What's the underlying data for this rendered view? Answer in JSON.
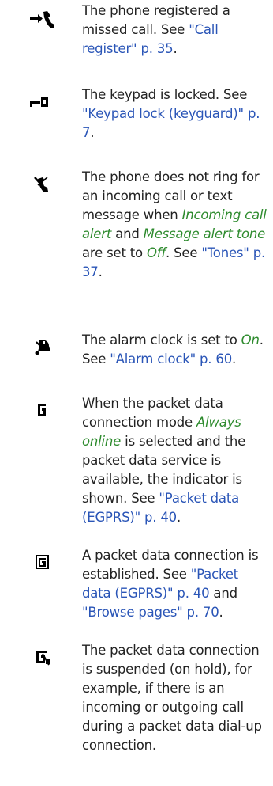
{
  "colors": {
    "text": "#222222",
    "link": "#2a55b7",
    "emphasis": "#2e8b2e"
  },
  "entries": [
    {
      "icon": "missed-call-icon",
      "t1": "The phone registered a missed call. See ",
      "l1": "\"Call register\" p. 35",
      "t2": "."
    },
    {
      "icon": "keypad-lock-icon",
      "t1": "The keypad is locked. See ",
      "l1": "\"Keypad lock (keyguard)\" p. 7",
      "t2": "."
    },
    {
      "icon": "silent-ringing-icon",
      "t1": "The phone does not ring for an incoming call or text message when ",
      "e1": "Incoming call alert",
      "t2": " and ",
      "e2": "Message alert tone",
      "t3": " are set to ",
      "e3": "Off",
      "t4": ". See ",
      "l1": "\"Tones\" p. 37",
      "t5": "."
    },
    {
      "icon": "alarm-clock-icon",
      "t1": "The alarm clock is set to ",
      "e1": "On",
      "t2": ". See ",
      "l1": "\"Alarm clock\" p. 60",
      "t3": "."
    },
    {
      "icon": "packet-data-available-icon",
      "t1": "When the packet data connection mode ",
      "e1": "Always online",
      "t2": " is selected and the packet data service is available, the indicator is shown. See ",
      "l1": "\"Packet data (EGPRS)\" p. 40",
      "t3": "."
    },
    {
      "icon": "packet-data-established-icon",
      "t1": "A packet data connection is established. See ",
      "l1": "\"Packet data (EGPRS)\" p. 40",
      "t2": " and ",
      "l2": "\"Browse pages\" p. 70",
      "t3": "."
    },
    {
      "icon": "packet-data-suspended-icon",
      "t1": "The packet data connection is suspended (on hold), for example, if there is an incoming or outgoing call during a packet data dial-up connection."
    }
  ]
}
